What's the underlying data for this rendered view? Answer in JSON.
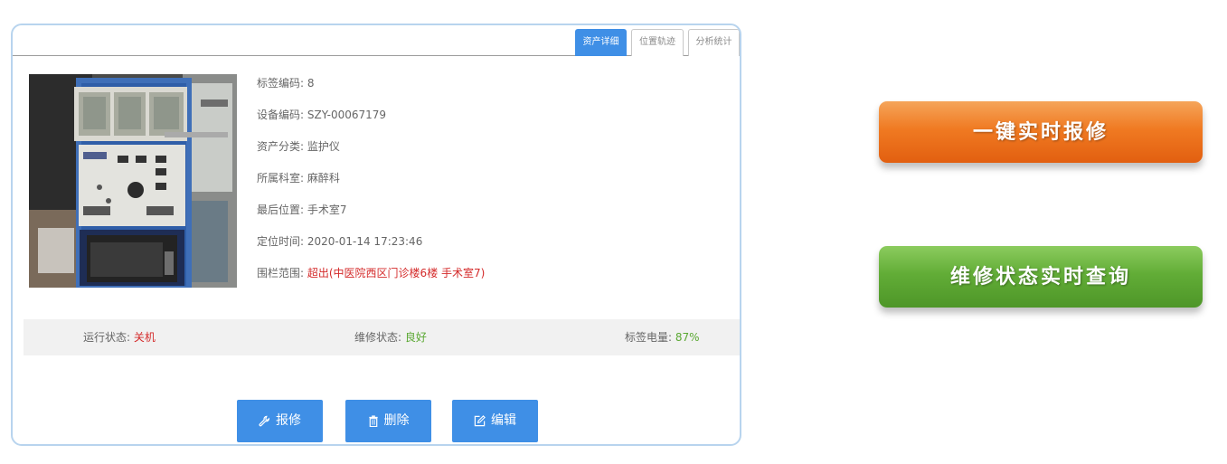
{
  "tabs": [
    {
      "label": "资产详细",
      "active": true
    },
    {
      "label": "位置轨迹",
      "active": false
    },
    {
      "label": "分析统计",
      "active": false
    }
  ],
  "info": [
    {
      "label": "标签编码:",
      "value": "8"
    },
    {
      "label": "设备编码:",
      "value": "SZY-00067179"
    },
    {
      "label": "资产分类:",
      "value": "监护仪"
    },
    {
      "label": "所属科室:",
      "value": "麻醉科"
    },
    {
      "label": "最后位置:",
      "value": "手术室7"
    },
    {
      "label": "定位时间:",
      "value": "2020-01-14 17:23:46"
    },
    {
      "label": "围栏范围:",
      "value": "超出(中医院西区门诊楼6楼 手术室7)"
    }
  ],
  "status": {
    "run_label": "运行状态:",
    "run_value": "关机",
    "repair_label": "维修状态:",
    "repair_value": "良好",
    "battery_label": "标签电量:",
    "battery_value": "87%"
  },
  "actions": {
    "repair": "报修",
    "delete": "删除",
    "edit": "编辑"
  },
  "big_buttons": {
    "report": "一键实时报修",
    "query": "维修状态实时查询"
  },
  "colors": {
    "primary": "#3f8fe6",
    "alert_red": "#d42a2a",
    "ok_green": "#5aa832",
    "orange": "#f07a22",
    "green": "#62ad37"
  },
  "icons": {
    "repair": "wrench-icon",
    "delete": "trash-icon",
    "edit": "edit-icon"
  }
}
